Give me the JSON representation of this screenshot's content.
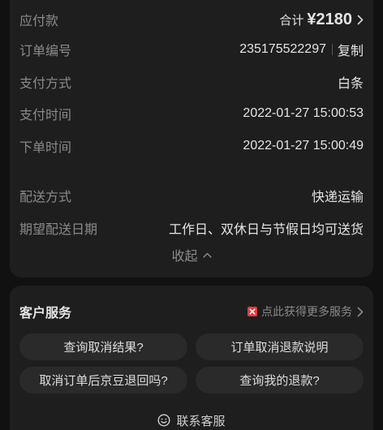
{
  "colors": {
    "page_background": "#111111",
    "card_background": "#1e1e1e",
    "button_background": "#2a2a2a",
    "label_text": "#8a8a8a",
    "value_text": "#e4e4e4",
    "service_badge": "#e4393c"
  },
  "order_details": {
    "amount_due": {
      "label": "应付款",
      "total_prefix": "合计",
      "amount": "¥2180",
      "icon": "chevron-right-icon"
    },
    "order_number": {
      "label": "订单编号",
      "value": "235175522297",
      "copy_label": "复制"
    },
    "payment_method": {
      "label": "支付方式",
      "value": "白条"
    },
    "payment_time": {
      "label": "支付时间",
      "value": "2022-01-27 15:00:53"
    },
    "order_time": {
      "label": "下单时间",
      "value": "2022-01-27 15:00:49"
    },
    "delivery_method": {
      "label": "配送方式",
      "value": "快递运输"
    },
    "expected_delivery_date": {
      "label": "期望配送日期",
      "value": "工作日、双休日与节假日均可送货"
    },
    "collapse": {
      "label": "收起",
      "icon": "chevron-up-icon"
    }
  },
  "customer_service": {
    "title": "客户服务",
    "more_services": {
      "label": "点此获得更多服务",
      "icon": "service-badge-icon",
      "chevron": "chevron-right-icon"
    },
    "questions": [
      "查询取消结果?",
      "订单取消退款说明",
      "取消订单后京豆退回吗?",
      "查询我的退款?"
    ],
    "contact": {
      "label": "联系客服",
      "icon": "customer-service-icon"
    }
  }
}
